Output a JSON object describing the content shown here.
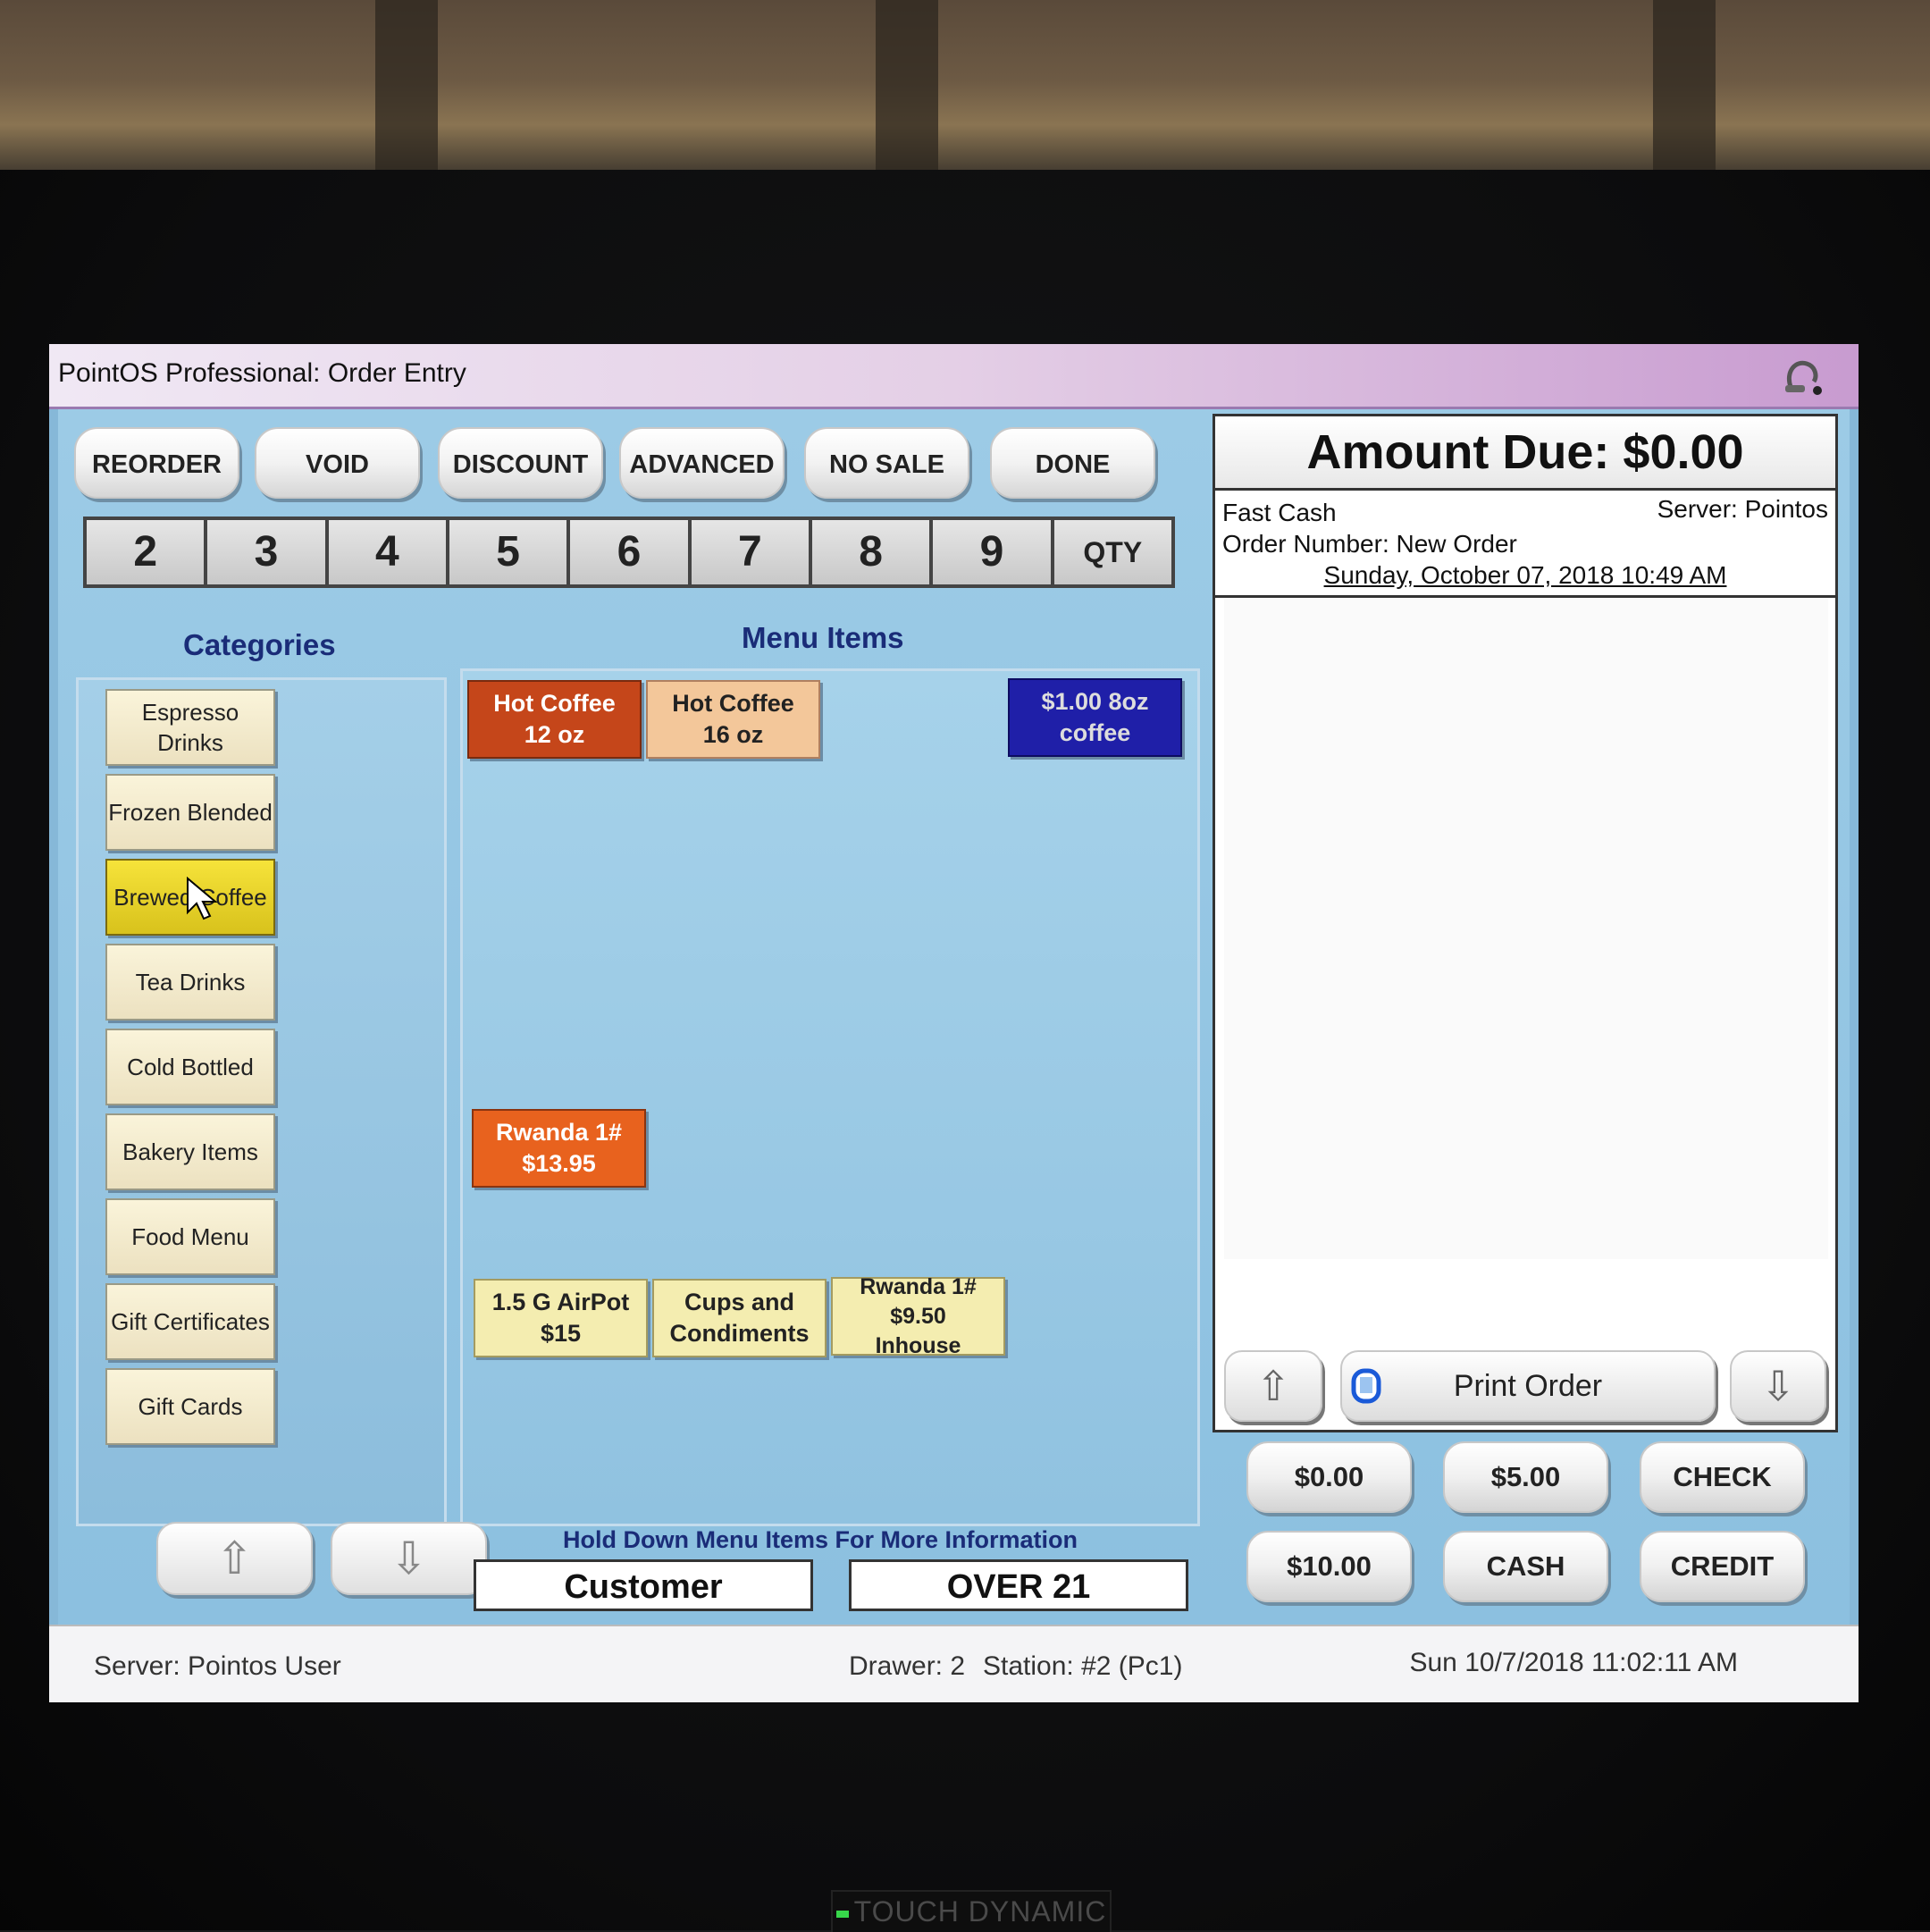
{
  "window": {
    "title": "PointOS Professional: Order Entry"
  },
  "toolbar": {
    "reorder": "REORDER",
    "void": "VOID",
    "discount": "DISCOUNT",
    "advanced": "ADVANCED",
    "no_sale": "NO SALE",
    "done": "DONE"
  },
  "numpad": [
    "2",
    "3",
    "4",
    "5",
    "6",
    "7",
    "8",
    "9",
    "QTY"
  ],
  "labels": {
    "categories": "Categories",
    "menu_items": "Menu Items",
    "hold_hint": "Hold Down Menu Items For More Information"
  },
  "categories": [
    "Espresso Drinks",
    "Frozen Blended",
    "Brewed Coffee",
    "Tea Drinks",
    "Cold Bottled",
    "Bakery Items",
    "Food Menu",
    "Gift Certificates",
    "Gift Cards"
  ],
  "selected_category": "Brewed Coffee",
  "menu_items": [
    {
      "label": "Hot Coffee\n12 oz",
      "color": "#c5461a"
    },
    {
      "label": "Hot Coffee\n16 oz",
      "color": "#f3c79a"
    },
    {
      "label": "$1.00 8oz\ncoffee",
      "color": "#1f1fa8"
    },
    {
      "label": "Rwanda 1#\n$13.95",
      "color": "#e8621e"
    },
    {
      "label": "1.5 G AirPot\n$15",
      "color": "#f4edb0"
    },
    {
      "label": "Cups and\nCondiments",
      "color": "#f4edb0"
    },
    {
      "label": "Rwanda 1#\n$9.50\nInhouse",
      "color": "#f4edb0"
    }
  ],
  "info_boxes": {
    "customer": "Customer",
    "over21": "OVER 21"
  },
  "order": {
    "amount_due": "Amount Due: $0.00",
    "type": "Fast Cash",
    "server": "Server: Pointos",
    "order_number": "Order Number: New Order",
    "date": "Sunday, October 07, 2018 10:49 AM",
    "print_label": "Print Order"
  },
  "payment": {
    "b1": "$0.00",
    "b2": "$5.00",
    "check": "CHECK",
    "b3": "$10.00",
    "cash": "CASH",
    "credit": "CREDIT"
  },
  "status": {
    "server": "Server: Pointos User",
    "drawer": "Drawer: 2",
    "station": "Station: #2 (Pc1)",
    "datetime": "Sun 10/7/2018 11:02:11 AM"
  },
  "bezel": {
    "brand": "TOUCH DYNAMIC"
  }
}
